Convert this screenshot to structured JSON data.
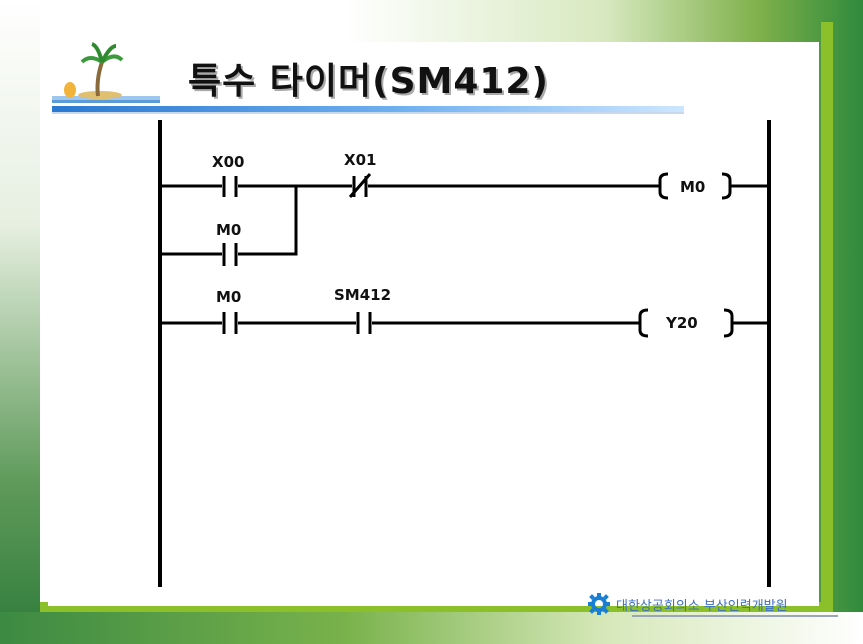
{
  "slide": {
    "title": "특수 타이머(SM412)",
    "footer": "대한상공회의소 부산인력개발원"
  },
  "ladder": {
    "rungs": [
      {
        "contacts": [
          {
            "label": "X00",
            "type": "NO"
          },
          {
            "label": "X01",
            "type": "NC"
          }
        ],
        "branch": {
          "label": "M0",
          "type": "NO"
        },
        "coil": "M0"
      },
      {
        "contacts": [
          {
            "label": "M0",
            "type": "NO"
          },
          {
            "label": "SM412",
            "type": "NO"
          }
        ],
        "coil": "Y20"
      }
    ]
  },
  "colors": {
    "accent": "#8cc02a",
    "title_bar": "#2a78d0",
    "footer_text": "#3d6fc4"
  },
  "icons": [
    "palm-tree-icon",
    "gear-logo-icon"
  ]
}
